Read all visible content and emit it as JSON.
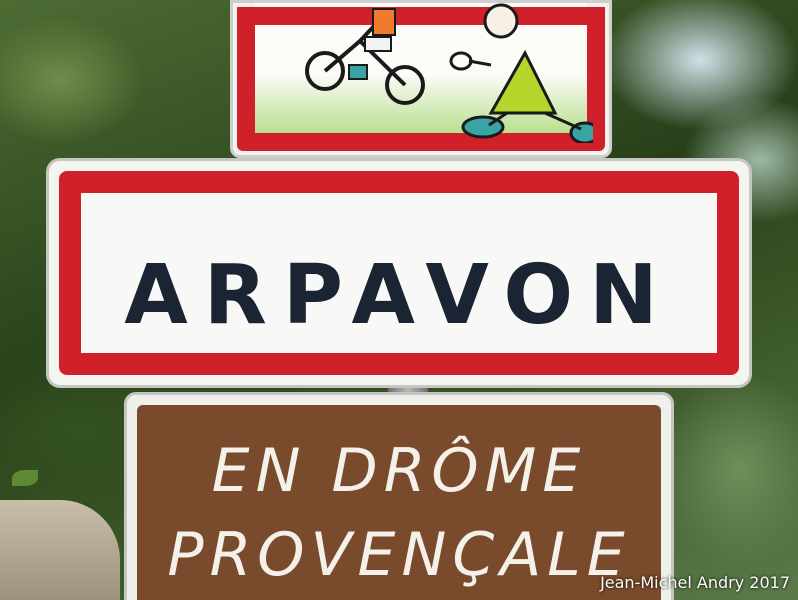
{
  "signs": {
    "town_name": "ARPAVON",
    "region_line1": "EN DRÔME",
    "region_line2": "PROVENÇALE"
  },
  "credit": "Jean-Michel Andry 2017",
  "colors": {
    "sign_red": "#d0212b",
    "town_text": "#1b2432",
    "region_brown": "#7a4a2c"
  }
}
